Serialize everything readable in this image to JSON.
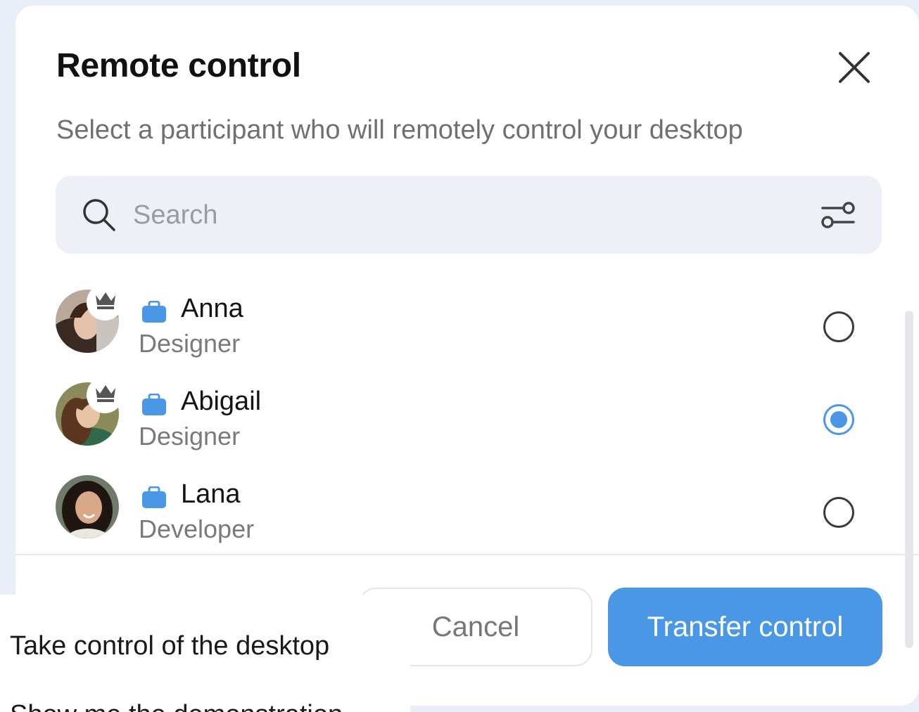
{
  "dialog": {
    "title": "Remote control",
    "subtitle": "Select a participant who will remotely control your desktop",
    "close_icon": "close-icon"
  },
  "search": {
    "placeholder": "Search",
    "value": "",
    "icon": "search-icon",
    "filter_icon": "filter-sliders-icon"
  },
  "participants": [
    {
      "name": "Anna",
      "role": "Designer",
      "host": true,
      "selected": false
    },
    {
      "name": "Abigail",
      "role": "Designer",
      "host": true,
      "selected": true
    },
    {
      "name": "Lana",
      "role": "Developer",
      "host": false,
      "selected": false
    }
  ],
  "buttons": {
    "cancel": "Cancel",
    "transfer": "Transfer control"
  },
  "popup_menu": {
    "items": [
      "Take control of the desktop",
      "Show me the demonstration"
    ]
  },
  "colors": {
    "accent": "#4a98e5",
    "badge": "#4a98e5",
    "search_bg": "#eef0f7",
    "page_bg": "#e9eef8"
  }
}
